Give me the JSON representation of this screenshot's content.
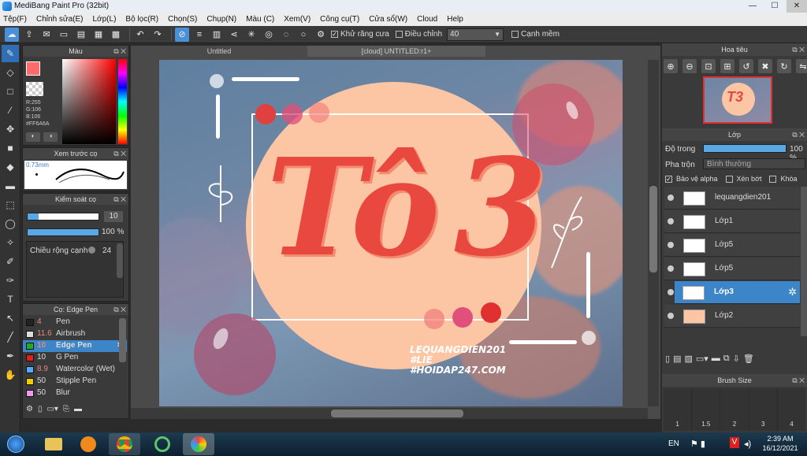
{
  "window": {
    "title": "MediBang Paint Pro (32bit)",
    "minimize": "—",
    "maximize": "☐",
    "close": "✕"
  },
  "menu": [
    "Tệp(F)",
    "Chỉnh sửa(E)",
    "Lớp(L)",
    "Bộ lọc(R)",
    "Chọn(S)",
    "Chụp(N)",
    "Màu (C)",
    "Xem(V)",
    "Công cụ(T)",
    "Cửa sổ(W)",
    "Cloud",
    "Help"
  ],
  "toolbar": {
    "antialias_label": "Khử răng cưa",
    "correction_label": "Điều chỉnh",
    "correction_value": "40",
    "smooth_label": "Cạnh mềm"
  },
  "color_panel": {
    "title": "Màu",
    "r": "R:255",
    "g": "G:106",
    "b": "B:106",
    "hex": "#FF6A6A",
    "primary": "#ff6a6a"
  },
  "preview_panel": {
    "title": "Xem trước cọ",
    "size": "0.73mm"
  },
  "brush_control": {
    "title": "Kiểm soát cọ",
    "size_value": "10",
    "opacity_value": "100 %",
    "width_label": "Chiều rộng cạnh",
    "width_value": "24"
  },
  "brush_list": {
    "title": "Cọ: Edge Pen",
    "items": [
      {
        "size": "4",
        "name": "Pen",
        "color": "#222222"
      },
      {
        "size": "11.6",
        "name": "Airbrush",
        "color": "#dddddd"
      },
      {
        "size": "10",
        "name": "Edge Pen",
        "color": "#22aa22"
      },
      {
        "size": "10",
        "name": "G Pen",
        "color": "#dd2222"
      },
      {
        "size": "8.9",
        "name": "Watercolor (Wet)",
        "color": "#55aaff"
      },
      {
        "size": "50",
        "name": "Stipple Pen",
        "color": "#eecc00"
      },
      {
        "size": "50",
        "name": "Blur",
        "color": "#ee99ee"
      }
    ]
  },
  "tabs": {
    "tab1": "Untitled",
    "tab2": "[cloud] UNTITLED:r1+"
  },
  "artwork": {
    "title_left": "Tô",
    "title_right": "3",
    "accent": "̉",
    "credit1": "LEQUANGDIEN201",
    "credit2": "#LIE",
    "credit3": "#HOIDAP247.COM"
  },
  "navigator": {
    "title": "Hoa tiêu"
  },
  "layers": {
    "title": "Lớp",
    "opacity_label": "Độ trong",
    "opacity_value": "100 %",
    "blend_label": "Pha trộn",
    "blend_value": "Bình thường",
    "protect_alpha": "Bảo vệ alpha",
    "clip": "Xén bớt",
    "lock": "Khóa",
    "items": [
      {
        "name": "lequangdien201",
        "selected": false
      },
      {
        "name": "Lớp1",
        "selected": false
      },
      {
        "name": "Lớp5",
        "selected": false
      },
      {
        "name": "Lớp5",
        "selected": false
      },
      {
        "name": "Lớp3",
        "selected": true
      },
      {
        "name": "Lớp2",
        "selected": false
      }
    ]
  },
  "brush_size": {
    "title": "Brush Size",
    "sizes": [
      "1",
      "1.5",
      "2",
      "3",
      "4"
    ]
  },
  "taskbar": {
    "lang": "EN",
    "time": "2:39 AM",
    "date": "16/12/2021"
  }
}
